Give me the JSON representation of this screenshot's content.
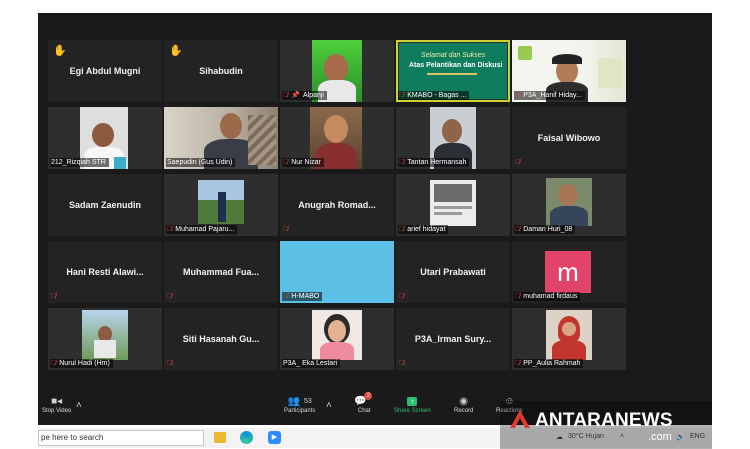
{
  "participants": [
    {
      "name": "Egi Abdul Mugni",
      "video": false,
      "hand": true,
      "muted": false,
      "label_style": "center"
    },
    {
      "name": "Sihabudin",
      "video": false,
      "hand": true,
      "muted": false,
      "label_style": "center"
    },
    {
      "name": "Alpanji",
      "video": true,
      "hand": false,
      "muted": true,
      "label_style": "tag",
      "pinned": true
    },
    {
      "name": "KMABO - Bagas ...",
      "video": true,
      "hand": false,
      "muted": true,
      "label_style": "tag",
      "active": true,
      "banner_line1": "Selamat dan Sukses",
      "banner_line2": "Atas Pelantikan dan Diskusi"
    },
    {
      "name": "P3A_Hanif Hiday...",
      "video": true,
      "hand": false,
      "muted": true,
      "label_style": "tag"
    },
    {
      "name": "212_Rizqiah STR",
      "video": true,
      "hand": false,
      "muted": false,
      "label_style": "tag"
    },
    {
      "name": "Saepudin (Gus Udin)",
      "video": true,
      "hand": false,
      "muted": false,
      "label_style": "tag"
    },
    {
      "name": "Nur Nizar",
      "video": true,
      "hand": false,
      "muted": true,
      "label_style": "tag"
    },
    {
      "name": "Tantan Hermansah",
      "video": true,
      "hand": false,
      "muted": true,
      "label_style": "tag"
    },
    {
      "name": "Faisal Wibowo",
      "video": false,
      "hand": false,
      "muted": true,
      "label_style": "center"
    },
    {
      "name": "Sadam Zaenudin",
      "video": false,
      "hand": false,
      "muted": false,
      "label_style": "center"
    },
    {
      "name": "Muhamad Pajaru...",
      "video": true,
      "hand": false,
      "muted": true,
      "label_style": "tag"
    },
    {
      "name": "Anugrah Romad...",
      "video": false,
      "hand": false,
      "muted": true,
      "label_style": "center"
    },
    {
      "name": "arief hidayat",
      "video": true,
      "hand": false,
      "muted": true,
      "label_style": "tag"
    },
    {
      "name": "Daman Huri_08",
      "video": true,
      "hand": false,
      "muted": true,
      "label_style": "tag"
    },
    {
      "name": "Hani Resti Alawi...",
      "video": false,
      "hand": false,
      "muted": true,
      "label_style": "center"
    },
    {
      "name": "Muhammad Fua...",
      "video": false,
      "hand": false,
      "muted": true,
      "label_style": "center"
    },
    {
      "name": "H-MABO",
      "video": true,
      "hand": false,
      "muted": true,
      "label_style": "tag",
      "blue": true
    },
    {
      "name": "Utari Prabawati",
      "video": false,
      "hand": false,
      "muted": true,
      "label_style": "center"
    },
    {
      "name": "muhamad firdaus",
      "video": false,
      "hand": false,
      "muted": true,
      "label_style": "tag",
      "avatar_letter": "m"
    },
    {
      "name": "Nurul Hadi (Hm)",
      "video": true,
      "hand": false,
      "muted": true,
      "label_style": "tag"
    },
    {
      "name": "Siti Hasanah Gu...",
      "video": false,
      "hand": false,
      "muted": true,
      "label_style": "center"
    },
    {
      "name": "P3A_ Eka Lestari",
      "video": true,
      "hand": false,
      "muted": true,
      "label_style": "tag"
    },
    {
      "name": "P3A_Irman Sury...",
      "video": false,
      "hand": false,
      "muted": true,
      "label_style": "center"
    },
    {
      "name": "PP_Aulia Rahmah",
      "video": true,
      "hand": false,
      "muted": true,
      "label_style": "tag"
    }
  ],
  "toolbar": {
    "stop_video": "Stop Video",
    "participants": "Participants",
    "participants_count": "53",
    "chat": "Chat",
    "chat_badge": "2",
    "share_screen": "Share Screen",
    "record": "Record",
    "reactions": "Reactions"
  },
  "taskbar": {
    "search_placeholder": "pe here to search",
    "weather": "30°C  Hujan",
    "language": "ENG"
  },
  "watermark": {
    "brand": "ANTARANEWS",
    "suffix": ".com"
  },
  "colors": {
    "zoom_bg": "#1a1a1a",
    "tile_bg": "#232323",
    "active_speaker": "#c9d433",
    "muted": "#e0483a",
    "share_screen": "#2fbf71",
    "hand": "#f5c043"
  }
}
